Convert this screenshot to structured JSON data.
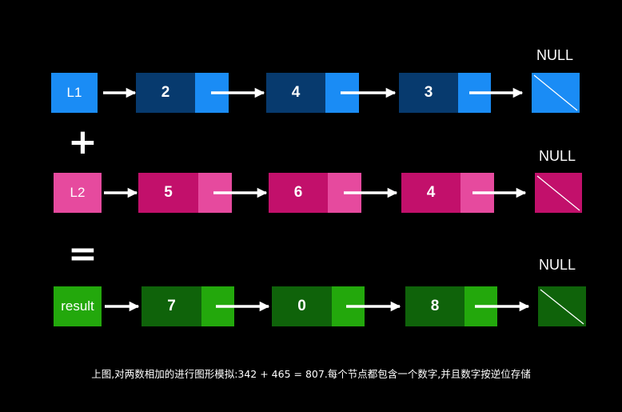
{
  "lists": [
    {
      "head_label": "L1",
      "values": [
        "2",
        "4",
        "3"
      ],
      "null_label": "NULL",
      "colors": {
        "head": "#1a8cf5",
        "node": "#073a6e",
        "pointer": "#1a8cf5",
        "null_box": "#1a8cf5"
      }
    },
    {
      "head_label": "L2",
      "values": [
        "5",
        "6",
        "4"
      ],
      "null_label": "NULL",
      "colors": {
        "head": "#e64a9e",
        "node": "#c2106b",
        "pointer": "#e64a9e",
        "null_box": "#c2106b"
      }
    },
    {
      "head_label": "result",
      "values": [
        "7",
        "0",
        "8"
      ],
      "null_label": "NULL",
      "colors": {
        "head": "#23a80c",
        "node": "#0f630a",
        "pointer": "#23a80c",
        "null_box": "#0f630a"
      }
    }
  ],
  "operators": {
    "plus": "+",
    "equals": "="
  },
  "caption": "上图,对两数相加的进行图形模拟:342 + 465 = 807.每个节点都包含一个数字,并且数字按逆位存储"
}
